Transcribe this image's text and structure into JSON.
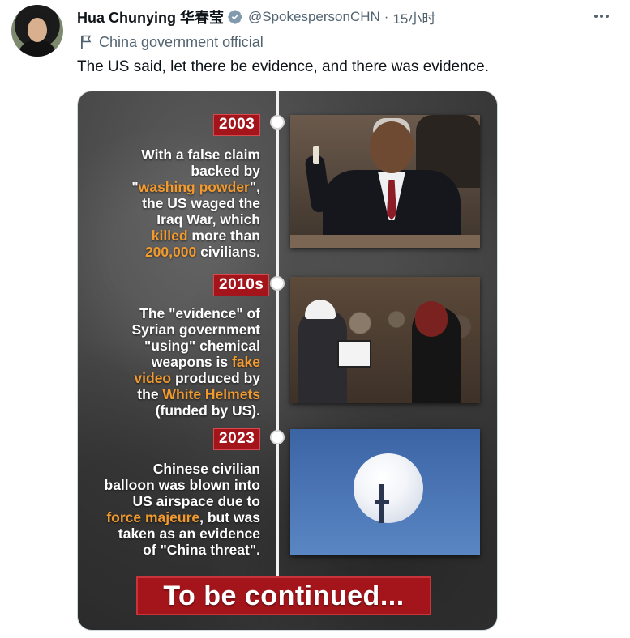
{
  "author": {
    "name": "Hua Chunying 华春莹",
    "handle": "@SpokespersonCHN",
    "separator": "·",
    "time": "15小时",
    "affiliation": "China government official"
  },
  "tweet": {
    "text": "The US said, let there be evidence, and there was evidence."
  },
  "icons": {
    "verified": "verified-badge-icon",
    "more": "more-options-icon",
    "flag": "flag-icon"
  },
  "colors": {
    "year_badge": "#a4151b",
    "highlight": "#f29a2e",
    "verified": "#1d9bf0"
  },
  "infographic": {
    "entries": [
      {
        "year": "2003",
        "lines": [
          [
            "With a false claim"
          ],
          [
            "backed by"
          ],
          [
            "\"",
            "washing powder",
            "\","
          ],
          [
            "the US waged the"
          ],
          [
            "Iraq War, which"
          ],
          [
            "",
            "killed",
            " more than"
          ],
          [
            "",
            "200,000",
            " civilians."
          ]
        ]
      },
      {
        "year": "2010s",
        "lines": [
          [
            "The \"evidence\" of"
          ],
          [
            "Syrian government"
          ],
          [
            "\"using\" chemical"
          ],
          [
            "weapons is ",
            "fake",
            ""
          ],
          [
            "",
            "video",
            " produced by"
          ],
          [
            "the ",
            "White Helmets",
            ""
          ],
          [
            "(funded by US)."
          ]
        ]
      },
      {
        "year": "2023",
        "lines": [
          [
            "Chinese civilian"
          ],
          [
            "balloon was blown into"
          ],
          [
            "US airspace due to"
          ],
          [
            "",
            "force majeure",
            ", but was"
          ],
          [
            "taken as an evidence"
          ],
          [
            "of \"China threat\"."
          ]
        ]
      }
    ],
    "footer": "To be continued..."
  }
}
